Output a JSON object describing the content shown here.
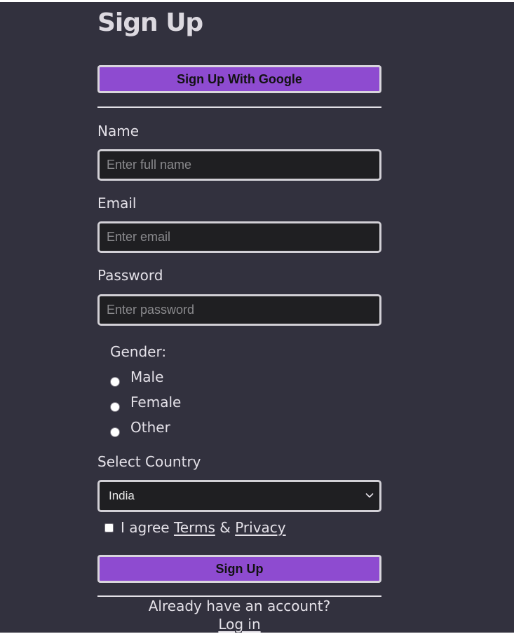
{
  "page": {
    "title": "Sign Up",
    "background_color": "#32313e",
    "accent_color": "#8e4bd0"
  },
  "buttons": {
    "google_label": "Sign Up With Google",
    "submit_label": "Sign Up"
  },
  "fields": {
    "name": {
      "label": "Name",
      "placeholder": "Enter full name",
      "value": ""
    },
    "email": {
      "label": "Email",
      "placeholder": "Enter email",
      "value": ""
    },
    "password": {
      "label": "Password",
      "placeholder": "Enter password",
      "value": ""
    }
  },
  "gender": {
    "label": "Gender:",
    "options": [
      "Male",
      "Female",
      "Other"
    ],
    "selected": null
  },
  "country": {
    "label": "Select Country",
    "selected": "India",
    "icon": "chevron-down-icon"
  },
  "agreement": {
    "prefix": "I agree",
    "terms_link": "Terms",
    "separator": "&",
    "privacy_link": "Privacy",
    "checked": false
  },
  "footer": {
    "already_text": "Already have an account?",
    "login_link": "Log in"
  }
}
